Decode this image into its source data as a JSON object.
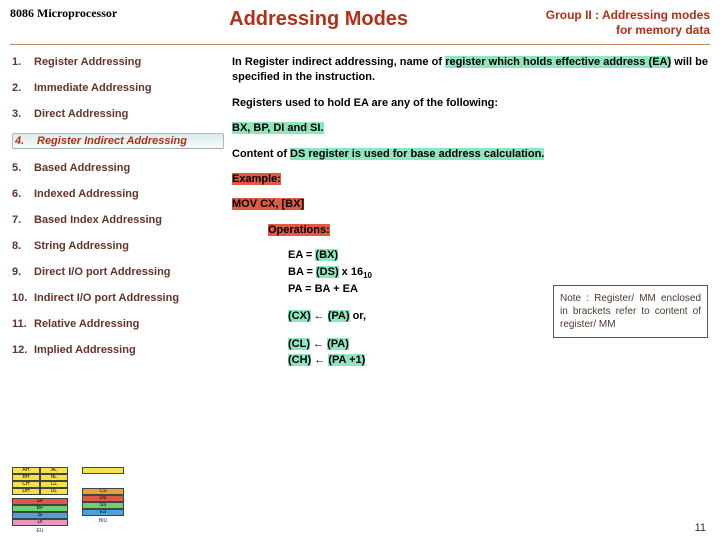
{
  "header": {
    "logo": "8086 Microprocessor",
    "title": "Addressing Modes",
    "subtitle_l1": "Group II : Addressing modes",
    "subtitle_l2": "for memory data"
  },
  "modes": [
    "Register Addressing",
    "Immediate Addressing",
    "Direct Addressing",
    "Register Indirect Addressing",
    "Based Addressing",
    "Indexed Addressing",
    "Based Index Addressing",
    "String Addressing",
    "Direct I/O port Addressing",
    "Indirect I/O port Addressing",
    "Relative Addressing",
    "Implied Addressing"
  ],
  "active_index": 3,
  "body": {
    "p1_a": "In Register indirect addressing, name of ",
    "p1_b": "register which holds effective address (EA)",
    "p1_c": " will be specified in the instruction.",
    "p2": "Registers used to hold EA are any of the following:",
    "p3": "BX, BP, DI and SI.",
    "p4_a": "Content of ",
    "p4_b": "DS register is used for base address calculation.",
    "ex_label": "Example:",
    "ex_code": "MOV CX, [BX]",
    "ops_label": "Operations:",
    "eq1_a": "EA = ",
    "eq1_b": "(BX)",
    "eq2_a": "BA = ",
    "eq2_b": "(DS)",
    "eq2_c": " x 16",
    "eq2_sub": "10",
    "eq3": "PA = BA + EA",
    "r1_a": "(CX)",
    "r1_arrow": " ← ",
    "r1_b": "(PA)",
    "r1_c": "   or,",
    "r2_a": "(CL)",
    "r2_arrow": " ← ",
    "r2_b": "(PA)",
    "r3_a": "(CH)",
    "r3_arrow": " ← ",
    "r3_b": " (PA +1)"
  },
  "note": "Note : Register/ MM enclosed in brackets refer to content of register/ MM",
  "page_num": "11",
  "diagram": {
    "eu_rows": [
      [
        "AH",
        "AL"
      ],
      [
        "BH",
        "BL"
      ],
      [
        "CH",
        "CL"
      ],
      [
        "DH",
        "DL"
      ]
    ],
    "eu_lower": [
      "SP",
      "BP",
      "SI",
      "DI"
    ],
    "biu_rows": [
      "CS",
      "DS",
      "SS",
      "ES"
    ],
    "eu_label": "EU",
    "biu_label": "BIU"
  }
}
